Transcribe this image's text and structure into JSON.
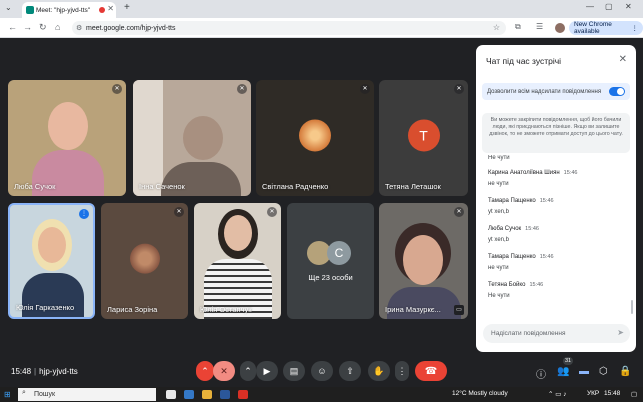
{
  "browser": {
    "tab_title": "Meet: \"hjp-yjvd-tts\"",
    "tab_close": "✕",
    "new_tab": "+",
    "url": "meet.google.com/hjp-yjvd-tts",
    "new_chrome": "New Chrome available",
    "nav": {
      "back": "←",
      "forward": "→",
      "reload": "↻",
      "home": "⌂"
    }
  },
  "participants": [
    {
      "name": "Люба Сучок",
      "bg": "#b9a27a"
    },
    {
      "name": "Інна Саченок",
      "bg": "#b8a89a"
    },
    {
      "name": "Світлана Радченко",
      "bg": "#2f2b26"
    },
    {
      "name": "Тетяна Леташок",
      "bg": "#3c3c3c",
      "initial": "T",
      "avatar_color": "#d94e2e"
    },
    {
      "name": "Юлія Гарказенко",
      "bg": "#c8d6de"
    },
    {
      "name": "Лариса Зоріна",
      "bg": "#5b4a3f"
    },
    {
      "name": "Юлія Остапчук",
      "bg": "#d7d1c7"
    },
    {
      "name": "Ще 23 особи",
      "bg": "#3c4043",
      "initial": "C",
      "avatar_color": "#8e9aa0"
    },
    {
      "name": "Ірина Мазуркє...",
      "bg": "#6d6a66"
    }
  ],
  "meeting": {
    "time": "15:48",
    "code": "hjp-yjvd-tts",
    "participants_count": "31"
  },
  "chat": {
    "title": "Чат під час зустрічі",
    "allow_label": "Дозволити всім надсилати повідомлення",
    "info_text": "Ви можете закріпити повідомлення, щоб його бачили люди, які приєднаються пізніше. Якщо ви залишите дзвінок, то не зможете отримати доступ до цього чату.",
    "first_text": "Не чути",
    "messages": [
      {
        "sender": "Карина Анатоліївна Шиян",
        "time": "15:46",
        "text": "не чути"
      },
      {
        "sender": "Тамара Пащенко",
        "time": "15:46",
        "text": "yt xen,b"
      },
      {
        "sender": "Люба Сучок",
        "time": "15:46",
        "text": "yt xen,b"
      },
      {
        "sender": "Тамара Пащенко",
        "time": "15:46",
        "text": "не чути"
      },
      {
        "sender": "Тетяна Бойко",
        "time": "15:46",
        "text": "Не чути"
      }
    ],
    "input_placeholder": "Надіслати повідомлення"
  },
  "taskbar": {
    "search_label": "Пошук",
    "weather": "12°C  Mostly cloudy",
    "lang": "УКР",
    "clock": "15:48"
  }
}
